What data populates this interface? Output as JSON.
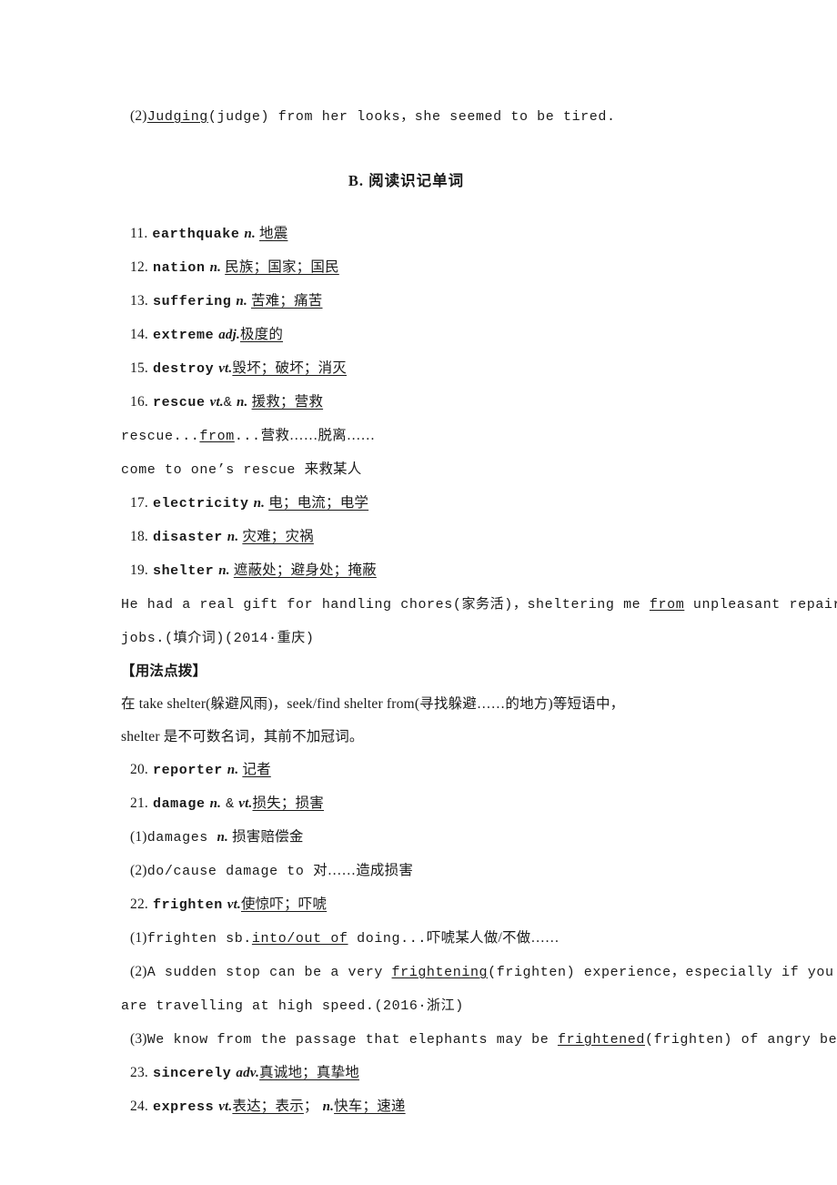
{
  "document": {
    "type": "english-vocabulary-workbook-page",
    "section_heading": "B. 阅读识记单词",
    "tip_label": "【用法点拨】"
  },
  "top_exercise": {
    "number": "(2)",
    "answer": "Judging",
    "cue": "(judge)",
    "rest": " from her looks，she seemed to be tired."
  },
  "entries": [
    {
      "num": "11.",
      "word": "earthquake",
      "pos": "n.",
      "gap": " ",
      "meaning": "地震"
    },
    {
      "num": "12.",
      "word": "nation",
      "pos": "n.",
      "gap": " ",
      "meaning": "民族；国家；国民"
    },
    {
      "num": "13.",
      "word": "suffering",
      "pos": "n.",
      "gap": " ",
      "meaning": "苦难；痛苦"
    },
    {
      "num": "14.",
      "word": "extreme",
      "pos": "adj.",
      "gap": "",
      "meaning": "极度的"
    },
    {
      "num": "15.",
      "word": "destroy",
      "pos": "vt.",
      "gap": "",
      "meaning": "毁坏；破坏；消灭"
    },
    {
      "num": "16.",
      "word": "rescue",
      "pos": "vt.",
      "pos_extra_plain": "&",
      "pos2": "n.",
      "gap": " ",
      "meaning": "援救；营救"
    }
  ],
  "rescue_phrases": [
    {
      "before": "rescue...",
      "blank": "from",
      "after_en": "...",
      "after_cn": "营救……脱离……"
    },
    {
      "en": "come to one’s rescue ",
      "cn": "来救某人"
    }
  ],
  "entries2": [
    {
      "num": "17.",
      "word": "electricity",
      "pos": "n.",
      "gap": " ",
      "meaning": "电；电流；电学"
    },
    {
      "num": "18.",
      "word": "disaster",
      "pos": "n.",
      "gap": " ",
      "meaning": "灾难；灾祸"
    },
    {
      "num": "19.",
      "word": "shelter",
      "pos": "n.",
      "gap": " ",
      "meaning": "遮蔽处；避身处；掩蔽"
    }
  ],
  "shelter_example": {
    "line1_a": "He had a real gift for handling chores(家务活)，sheltering me ",
    "line1_blank": "from",
    "line1_b": " unpleasant repair",
    "line2": "jobs.(填介词)(2014·重庆)"
  },
  "usage_tip": {
    "line1": "在 take shelter(躲避风雨)，seek/find shelter from(寻找躲避……的地方)等短语中，",
    "line2": "shelter 是不可数名词，其前不加冠词。"
  },
  "entries3": [
    {
      "num": "20.",
      "word": "reporter",
      "pos": "n.",
      "gap": " ",
      "meaning": "记者"
    },
    {
      "num": "21.",
      "word": "damage",
      "pos": "n.",
      "pos_extra_plain": "&",
      "pos2": "vt.",
      "gap": "",
      "meaning": "损失；损害"
    }
  ],
  "damage_subitems": [
    {
      "marker": "(1)",
      "en": "damages ",
      "pos": "n.",
      "cn": " 损害赔偿金"
    },
    {
      "marker": "(2)",
      "en": "do/cause damage to ",
      "pos": "",
      "cn": "对……造成损害"
    }
  ],
  "frighten_entry": {
    "num": "22.",
    "word": "frighten",
    "pos": "vt.",
    "gap": "",
    "meaning": "使惊吓；吓唬"
  },
  "frighten_subitems": [
    {
      "marker": "(1)",
      "before": "frighten sb.",
      "blank": "into/out of",
      "after_en": " doing...",
      "after_cn": "吓唬某人做/不做……"
    },
    {
      "marker": "(2)",
      "before": "A sudden stop can be a very ",
      "blank": "frightening",
      "cue": "(frighten)",
      "after_en": " experience，especially if you",
      "wrap_line": "are travelling at high speed.(2016·浙江)"
    },
    {
      "marker": "(3)",
      "before": "We know from the passage that elephants may be ",
      "blank": "frightened",
      "cue": "(frighten)",
      "after_en": " of angry bees."
    }
  ],
  "entries4": [
    {
      "num": "23.",
      "word": "sincerely",
      "pos": "adv.",
      "gap": "",
      "meaning": "真诚地；真挚地"
    },
    {
      "num": "24.",
      "word": "express",
      "pos": "vt.",
      "gap": "",
      "meaning": "表达；表示",
      "separator": "；",
      "pos2": "n.",
      "meaning2": "快车；速递"
    }
  ]
}
